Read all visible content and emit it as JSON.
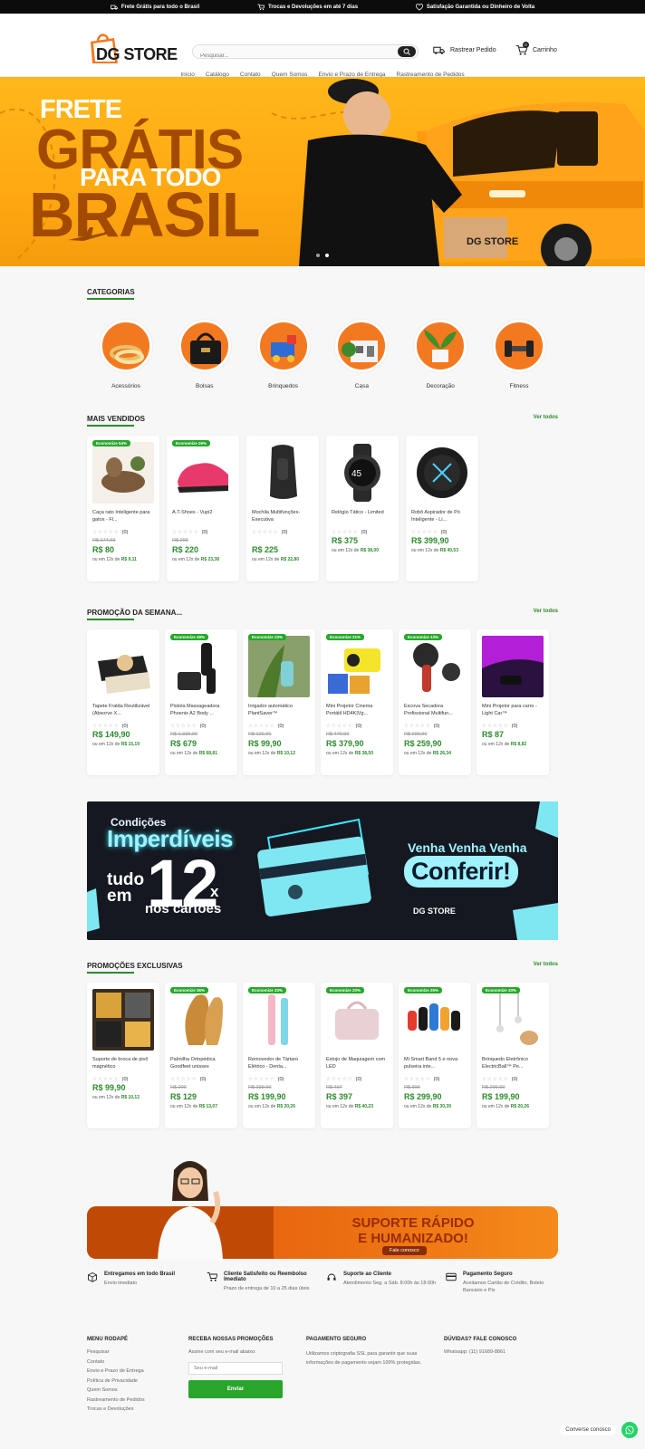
{
  "topbar": {
    "items": [
      {
        "icon": "truck-icon",
        "text": "Frete Grátis para todo o Brasil"
      },
      {
        "icon": "cart-return-icon",
        "text": "Trocas e Devoluções em até 7 dias"
      },
      {
        "icon": "heart-icon",
        "text": "Satisfação Garantida ou Dinheiro de Volta"
      }
    ]
  },
  "header": {
    "logo": "DG STORE",
    "search_placeholder": "Pesquisar...",
    "track_label": "Rastrear Pedido",
    "cart_label": "Carrinho",
    "cart_count": "0"
  },
  "nav": [
    "Início",
    "Catálogo",
    "Contato",
    "Quem Somos",
    "Envio e Prazo de Entrega",
    "Rastreamento de Pedidos"
  ],
  "hero": {
    "line1": "FRETE",
    "line2": "GRÁTIS",
    "line3": "PARA TODO",
    "line4": "BRASIL",
    "van_brand": "DG STORE",
    "slide_count": 2,
    "active_slide": 2
  },
  "categories": {
    "title": "CATEGORIAS",
    "items": [
      "Acessórios",
      "Bolsas",
      "Brinquedos",
      "Casa",
      "Decoração",
      "Fitness"
    ]
  },
  "mais_vendidos": {
    "title": "MAIS VENDIDOS",
    "see_all": "Ver todos",
    "products": [
      {
        "badge": "Economize 54%",
        "name": "Caça rato Inteligente para gatos - Fl...",
        "reviews": "(0)",
        "old": "R$ 174,93",
        "price": "R$ 80",
        "inst_prefix": "ou em 12x de",
        "inst": "R$ 9,11"
      },
      {
        "badge": "Economize 26%",
        "name": "A.T-Shoes - Vupi2",
        "reviews": "(0)",
        "old": "R$ 299",
        "price": "R$ 220",
        "inst_prefix": "ou em 12x de",
        "inst": "R$ 23,38"
      },
      {
        "badge": "",
        "name": "Mochila Multifunções- Executiva",
        "reviews": "(0)",
        "old": "",
        "price": "R$ 225",
        "inst_prefix": "ou em 12x de",
        "inst": "R$ 22,80"
      },
      {
        "badge": "",
        "name": "Relógio Tático - Limited",
        "reviews": "(0)",
        "old": "",
        "price": "R$ 375",
        "inst_prefix": "ou em 12x de",
        "inst": "R$ 38,00"
      },
      {
        "badge": "",
        "name": "Robô Aspirador de Pó Inteligente - Li...",
        "reviews": "(0)",
        "old": "",
        "price": "R$ 399,90",
        "inst_prefix": "ou em 12x de",
        "inst": "R$ 40,53"
      }
    ]
  },
  "promo_semana": {
    "title": "PROMOÇÃO DA SEMANA...",
    "see_all": "Ver todos",
    "products": [
      {
        "badge": "",
        "name": "Tapete Fralda Reutilizável (Absorve X...",
        "reviews": "(0)",
        "old": "",
        "price": "R$ 149,90",
        "inst_prefix": "ou em 12x de",
        "inst": "R$ 15,19"
      },
      {
        "badge": "Economize 49%",
        "name": "Pistola Massageadora Phoenix A2 Body ...",
        "reviews": "(0)",
        "old": "R$ 1.339,90",
        "price": "R$ 679",
        "inst_prefix": "ou em 12x de",
        "inst": "R$ 68,81"
      },
      {
        "badge": "Economize 23%",
        "name": "Irrigador automático PlantSaver™",
        "reviews": "(0)",
        "old": "R$ 129,90",
        "price": "R$ 99,90",
        "inst_prefix": "ou em 12x de",
        "inst": "R$ 10,12"
      },
      {
        "badge": "Economize 21%",
        "name": "Mini Projetor Cinema Portátil HD4K|Vg...",
        "reviews": "(0)",
        "old": "R$ 479,90",
        "price": "R$ 379,90",
        "inst_prefix": "ou em 12x de",
        "inst": "R$ 38,50"
      },
      {
        "badge": "Economize 13%",
        "name": "Escova Secadora Profissional Multifun...",
        "reviews": "(0)",
        "old": "R$ 299,90",
        "price": "R$ 259,90",
        "inst_prefix": "ou em 12x de",
        "inst": "R$ 26,34"
      },
      {
        "badge": "",
        "name": "Mini Projetor para carro - Light Car™",
        "reviews": "(0)",
        "old": "",
        "price": "R$ 87",
        "inst_prefix": "ou em 12x de",
        "inst": "R$ 8,82"
      }
    ]
  },
  "banner12": {
    "l1": "Condições",
    "l2": "Imperdíveis",
    "l3a": "tudo",
    "l3b": "em",
    "num": "12",
    "x": "x",
    "l4": "nos cartões",
    "venha": "Venha Venha Venha",
    "conferir": "Conferir!",
    "brand": "DG STORE"
  },
  "promo_exclusivas": {
    "title": "PROMOÇÕES EXCLUSIVAS",
    "see_all": "Ver todos",
    "products": [
      {
        "badge": "",
        "name": "Suporte de broca de pivô magnético",
        "reviews": "(0)",
        "old": "",
        "price": "R$ 99,90",
        "inst_prefix": "ou em 12x de",
        "inst": "R$ 10,12"
      },
      {
        "badge": "Economize 36%",
        "name": "Palmilha Ortopédica Goodfeet unissex",
        "reviews": "(0)",
        "old": "R$ 200",
        "price": "R$ 129",
        "inst_prefix": "ou em 12x de",
        "inst": "R$ 13,07"
      },
      {
        "badge": "Economize 33%",
        "name": "Removedor de Tártaro Elétrico - Denta...",
        "reviews": "(0)",
        "old": "R$ 299,90",
        "price": "R$ 199,90",
        "inst_prefix": "ou em 12x de",
        "inst": "R$ 20,26"
      },
      {
        "badge": "Economize 20%",
        "name": "Estojo de Maquiagem com LED",
        "reviews": "(0)",
        "old": "R$ 497",
        "price": "R$ 397",
        "inst_prefix": "ou em 12x de",
        "inst": "R$ 40,23"
      },
      {
        "badge": "Economize 25%",
        "name": "Mi Smart Band 5 e nova pulseira inte...",
        "reviews": "(0)",
        "old": "R$ 399",
        "price": "R$ 299,90",
        "inst_prefix": "ou em 12x de",
        "inst": "R$ 30,39"
      },
      {
        "badge": "Economize 33%",
        "name": "Brinquedo Eletrônico ElectricBall™ Pe...",
        "reviews": "(0)",
        "old": "R$ 299,90",
        "price": "R$ 199,90",
        "inst_prefix": "ou em 12x de",
        "inst": "R$ 20,26"
      }
    ]
  },
  "support": {
    "title1": "SUPORTE RÁPIDO",
    "title2": "E HUMANIZADO!",
    "button": "Fale conosco"
  },
  "features": [
    {
      "icon": "box-icon",
      "title": "Entregamos em todo Brasil",
      "desc": "Envio imediato"
    },
    {
      "icon": "cart-icon",
      "title": "Cliente Satisfeito ou Reembolso Imediato",
      "desc": "Prazo de entrega de 10 a 25 dias úteis"
    },
    {
      "icon": "headset-icon",
      "title": "Suporte ao Cliente",
      "desc": "Atendimento Seg. a Sáb. 8:00h às 18:00h"
    },
    {
      "icon": "card-icon",
      "title": "Pagamento Seguro",
      "desc": "Aceitamos Cartão de Crédito, Boleto Bancário e Pix"
    }
  ],
  "footer": {
    "menu_title": "MENU RODAPÉ",
    "menu": [
      "Pesquisar",
      "Contato",
      "Envio e Prazo de Entrega",
      "Política de Privacidade",
      "Quem Somos",
      "Rastreamento de Pedidos",
      "Trocas e Devoluções"
    ],
    "promo_title": "RECEBA NOSSAS PROMOÇÕES",
    "promo_desc": "Assine com seu e-mail abaixo:",
    "email_placeholder": "Seu e-mail",
    "send": "Enviar",
    "pay_title": "PAGAMENTO SEGURO",
    "pay_desc": "Utilizamos criptografia SSL para garantir que suas informações de pagamento sejam 100% protegidas.",
    "help_title": "DÚVIDAS? FALE CONOSCO",
    "whatsapp": "Whatsapp: (11) 91689-8861"
  },
  "chat_label": "Converse conosco",
  "colors": {
    "accent": "#2c8a2c",
    "badge": "#26a82a",
    "hero": "#ffb81c",
    "banner_bg": "#151820"
  }
}
